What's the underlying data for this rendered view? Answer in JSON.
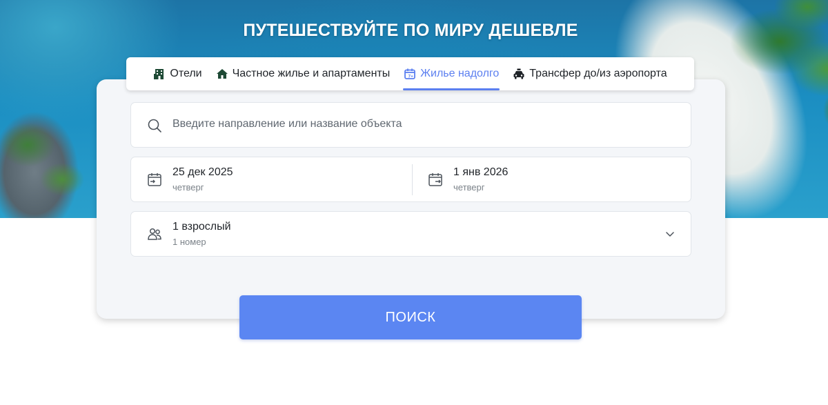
{
  "hero": {
    "title": "ПУТЕШЕСТВУЙТЕ ПО МИРУ ДЕШЕВЛЕ"
  },
  "tabs": [
    {
      "label": "Отели",
      "icon": "hotel-icon",
      "active": false
    },
    {
      "label": "Частное жилье и апартаменты",
      "icon": "house-icon",
      "active": false
    },
    {
      "label": "Жилье надолго",
      "icon": "calendar-stay-icon",
      "active": true
    },
    {
      "label": "Трансфер до/из аэропорта",
      "icon": "taxi-icon",
      "active": false
    }
  ],
  "search": {
    "placeholder": "Введите направление или название объекта",
    "icon": "search-icon"
  },
  "dates": {
    "checkin": {
      "date": "25 дек 2025",
      "weekday": "четверг",
      "icon": "check-in-calendar-icon"
    },
    "checkout": {
      "date": "1 янв 2026",
      "weekday": "четверг",
      "icon": "check-out-calendar-icon"
    }
  },
  "guests": {
    "people": "1 взрослый",
    "rooms": "1 номер",
    "icon": "people-icon",
    "dropdown_icon": "chevron-down-icon"
  },
  "button": {
    "label": "ПОИСК"
  },
  "colors": {
    "accent": "#5b7ff0",
    "button": "#5b86f2",
    "card_bg": "#f4f6f9",
    "text": "#1f2328",
    "muted": "#7b8289"
  }
}
